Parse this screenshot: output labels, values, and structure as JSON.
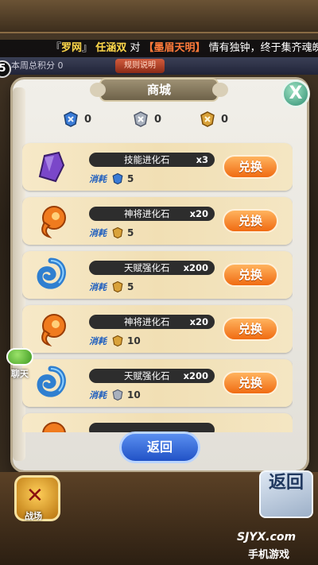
{
  "ticker": {
    "prefix": "『",
    "name1": "罗网",
    "suffix": "』",
    "player": "任涵双",
    "verb": "对",
    "name2": "【墨眉天明】",
    "message": "情有独钟，终于集齐魂魄"
  },
  "subbar": {
    "left": "本周总积分 0",
    "middle": "规则说明",
    "circle": "5"
  },
  "shop": {
    "title": "商城",
    "close": "X",
    "currencies": [
      {
        "icon": "blue-badge-icon",
        "value": "0",
        "color": "#3a7bd6"
      },
      {
        "icon": "silver-badge-icon",
        "value": "0",
        "color": "#9aa3b0"
      },
      {
        "icon": "gold-badge-icon",
        "value": "0",
        "color": "#d9a23a"
      }
    ],
    "cost_label": "消耗",
    "exchange_label": "兑换",
    "items": [
      {
        "name": "技能进化石",
        "qty": "x3",
        "icon": "purple-crystal-icon",
        "cost_icon": "blue-badge-icon",
        "cost": "5"
      },
      {
        "name": "神将进化石",
        "qty": "x20",
        "icon": "orange-magatama-icon",
        "cost_icon": "gold-badge-icon",
        "cost": "5"
      },
      {
        "name": "天赋强化石",
        "qty": "x200",
        "icon": "blue-swirl-icon",
        "cost_icon": "gold-badge-icon",
        "cost": "5"
      },
      {
        "name": "神将进化石",
        "qty": "x20",
        "icon": "orange-magatama-icon",
        "cost_icon": "gold-badge-icon",
        "cost": "10"
      },
      {
        "name": "天赋强化石",
        "qty": "x200",
        "icon": "blue-swirl-icon",
        "cost_icon": "silver-badge-icon",
        "cost": "10"
      },
      {
        "name": "",
        "qty": "",
        "icon": "orange-magatama-icon",
        "cost_icon": "gold-badge-icon",
        "cost": ""
      }
    ],
    "back": "返回"
  },
  "chat": {
    "label": "聊天"
  },
  "bottom": {
    "battle": "战场",
    "return": "返回"
  },
  "watermark": {
    "line1": "SJYX.com",
    "line2": "手机游戏"
  }
}
